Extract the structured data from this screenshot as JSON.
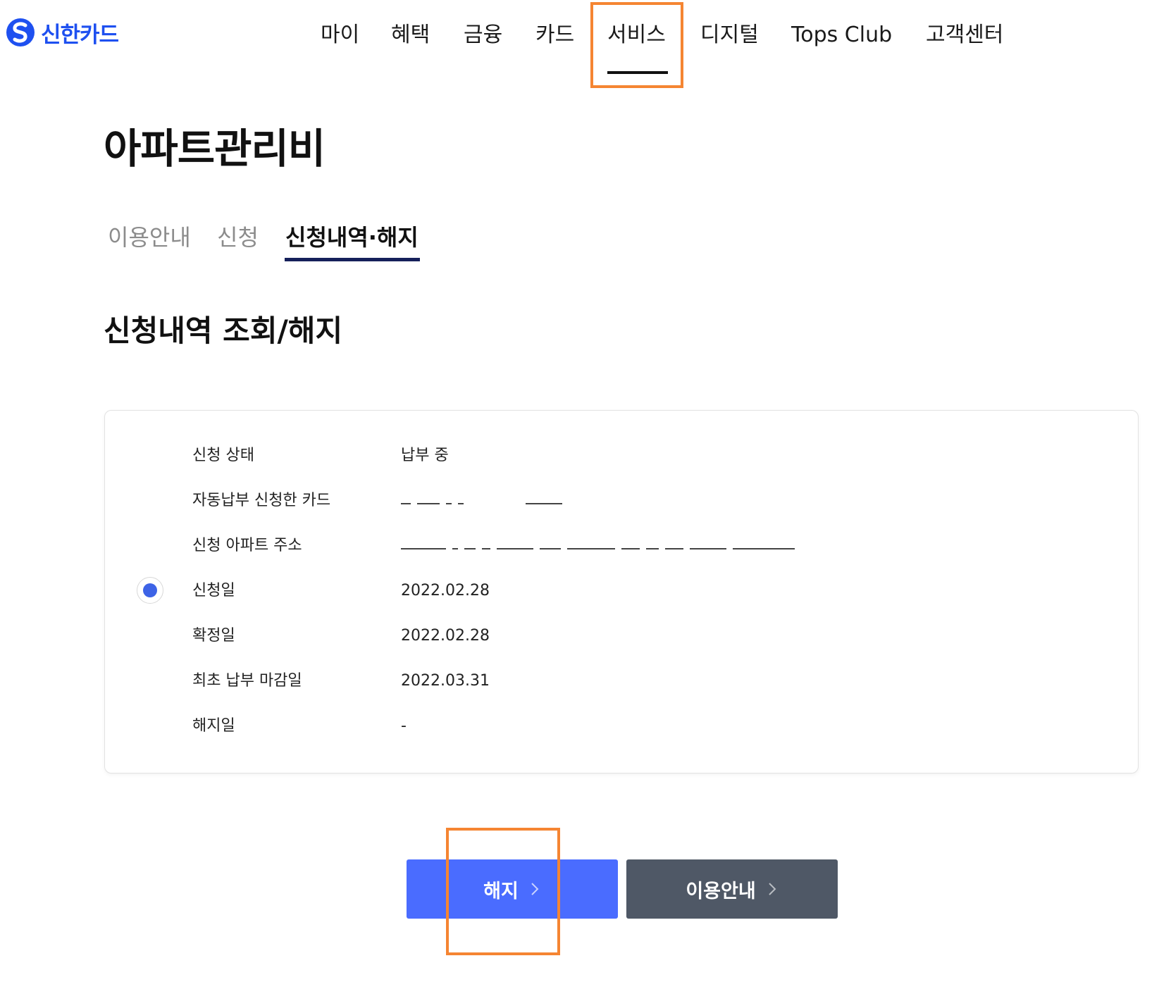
{
  "brand": {
    "name": "신한카드",
    "color": "#1e50f0"
  },
  "nav": {
    "items": [
      {
        "label": "마이"
      },
      {
        "label": "혜택"
      },
      {
        "label": "금융"
      },
      {
        "label": "카드"
      },
      {
        "label": "서비스",
        "active": true
      },
      {
        "label": "디지털"
      },
      {
        "label": "Tops Club"
      },
      {
        "label": "고객센터"
      }
    ]
  },
  "page": {
    "title": "아파트관리비",
    "tabs": [
      {
        "label": "이용안내"
      },
      {
        "label": "신청"
      },
      {
        "label": "신청내역·해지",
        "active": true
      }
    ],
    "section_title": "신청내역 조회/해지"
  },
  "details": {
    "rows": [
      {
        "label": "신청 상태",
        "value": "납부 중"
      },
      {
        "label": "자동납부 신청한 카드",
        "value": "",
        "masked": true
      },
      {
        "label": "신청 아파트 주소",
        "value": "",
        "masked": true
      },
      {
        "label": "신청일",
        "value": "2022.02.28"
      },
      {
        "label": "확정일",
        "value": "2022.02.28"
      },
      {
        "label": "최초 납부 마감일",
        "value": "2022.03.31"
      },
      {
        "label": "해지일",
        "value": "-"
      }
    ],
    "selected": true
  },
  "buttons": {
    "cancel_label": "해지",
    "guide_label": "이용안내"
  },
  "colors": {
    "highlight": "#f58532",
    "primary_button": "#4a6cff",
    "secondary_button": "#4f5866",
    "tab_underline": "#15205a",
    "radio": "#3d63e6"
  }
}
